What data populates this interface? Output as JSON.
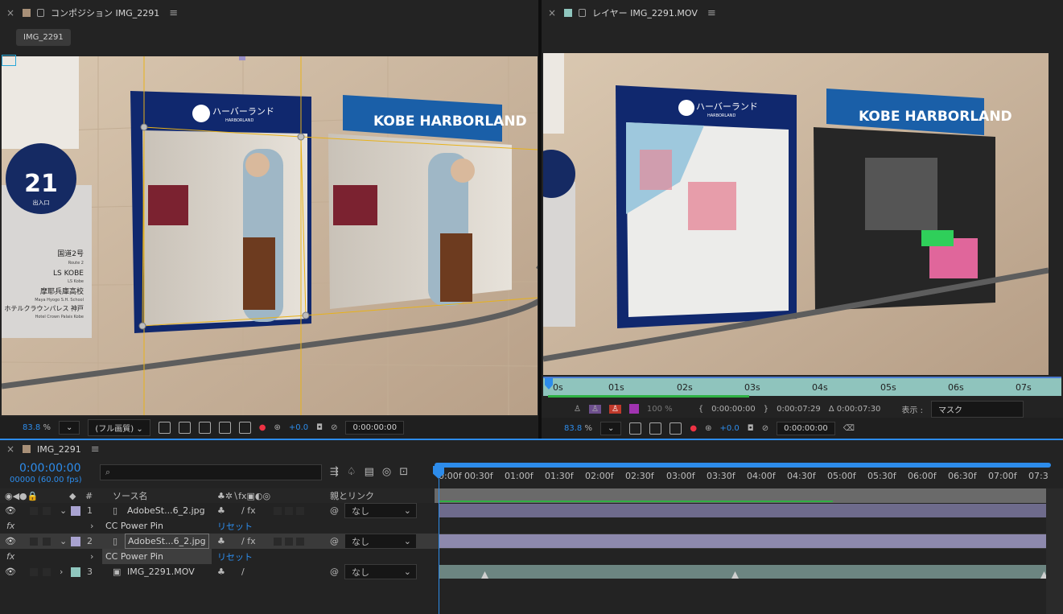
{
  "comp_panel": {
    "title": "コンポジション IMG_2291",
    "tab_chip": "IMG_2291",
    "zoom": "83.8",
    "zoom_unit": "%",
    "quality": "(フル画質)",
    "exposure": "+0.0",
    "timecode": "0:00:00:00",
    "sign_number": "21",
    "sign_sub": "出入口",
    "sign_lines": [
      "国道2号",
      "Route 2",
      "LS KOBE",
      "LS Kobe",
      "摩耶兵庫高校",
      "Maya Hyogo S.H. School",
      "ホテルクラウンパレス 神戸",
      "Hotel Crown Palais Kobe"
    ],
    "board_jp": "ハーバーランド",
    "board_en": "HARBORLAND",
    "kobe_sign": "KOBE HARBORLAND"
  },
  "layer_panel": {
    "title": "レイヤー IMG_2291.MOV",
    "ruler": [
      "0s",
      "01s",
      "02s",
      "03s",
      "04s",
      "05s",
      "06s",
      "07s"
    ],
    "opacity": "100 %",
    "in_time": "0:00:00:00",
    "out_time": "0:00:07:29",
    "duration": "Δ 0:00:07:30",
    "view_label": "表示 :",
    "view_value": "マスク",
    "zoom": "83.8",
    "zoom_unit": "%",
    "exposure": "+0.0",
    "timecode": "0:00:00:00",
    "board_jp": "ハーバーランド",
    "board_en": "HARBORLAND",
    "kobe_sign": "KOBE HARBORLAND"
  },
  "timeline": {
    "tab": "IMG_2291",
    "timecode": "0:00:00:00",
    "frames": "00000 (60.00 fps)",
    "search_placeholder": "",
    "col_num": "#",
    "col_source": "ソース名",
    "col_parent": "親とリンク",
    "ruler": [
      "0:00f",
      "00:30f",
      "01:00f",
      "01:30f",
      "02:00f",
      "02:30f",
      "03:00f",
      "03:30f",
      "04:00f",
      "04:30f",
      "05:00f",
      "05:30f",
      "06:00f",
      "06:30f",
      "07:00f",
      "07:3"
    ],
    "layers": [
      {
        "num": "1",
        "name": "AdobeSt...6_2.jpg",
        "parent": "なし",
        "color": "#a9a3d1",
        "effect": "CC Power Pin",
        "reset": "リセット"
      },
      {
        "num": "2",
        "name": "AdobeSt...6_2.jpg",
        "parent": "なし",
        "color": "#a9a3d1",
        "effect": "CC Power Pin",
        "reset": "リセット"
      },
      {
        "num": "3",
        "name": "IMG_2291.MOV",
        "parent": "なし",
        "color": "#8fc6be"
      }
    ],
    "fx_label": "fx"
  },
  "colors": {
    "accent": "#2d8ceb",
    "comp_swatch": "#a89078",
    "layer_swatch": "#8fc6be",
    "track_purple": "#6e6b8c",
    "track_teal": "#6c8581",
    "green_bar": "#2fb144"
  }
}
